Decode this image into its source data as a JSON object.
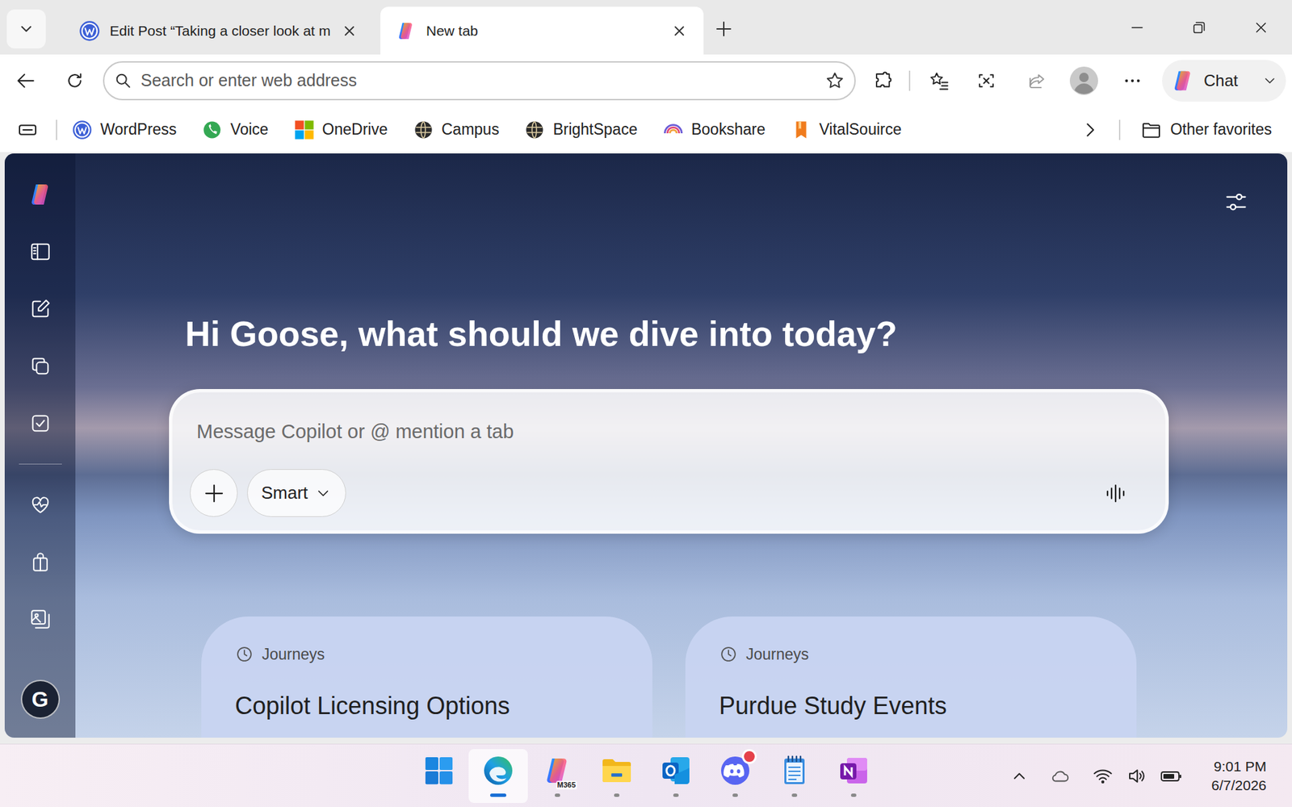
{
  "tabs": [
    {
      "label": "Edit Post “Taking a closer look at m",
      "selected": false,
      "kind": "wordpress"
    },
    {
      "label": "New tab",
      "selected": true,
      "kind": "copilot"
    }
  ],
  "address_bar": {
    "placeholder": "Search or enter web address"
  },
  "chat_button": {
    "label": "Chat"
  },
  "favorites": {
    "items": [
      {
        "label": "WordPress",
        "kind": "wordpress"
      },
      {
        "label": "Voice",
        "kind": "voice"
      },
      {
        "label": "OneDrive",
        "kind": "microsoft"
      },
      {
        "label": "Campus",
        "kind": "globe"
      },
      {
        "label": "BrightSpace",
        "kind": "globe"
      },
      {
        "label": "Bookshare",
        "kind": "bookshare"
      },
      {
        "label": "VitalSouirce",
        "kind": "vitalsource"
      }
    ],
    "other": "Other favorites"
  },
  "copilot": {
    "greeting": "Hi Goose, what should we dive into today?",
    "input": {
      "placeholder": "Message Copilot or @ mention a tab"
    },
    "mode": "Smart",
    "avatar": "G",
    "cards": [
      {
        "tag": "Journeys",
        "title": "Copilot Licensing Options"
      },
      {
        "tag": "Journeys",
        "title": "Purdue Study Events"
      }
    ]
  },
  "taskbar": {
    "apps": [
      {
        "kind": "start",
        "selected": false,
        "running": false,
        "notification": false
      },
      {
        "kind": "edge",
        "selected": true,
        "running": true,
        "notification": false
      },
      {
        "kind": "m365",
        "label": "M365",
        "selected": false,
        "running": true,
        "notification": false
      },
      {
        "kind": "explorer",
        "selected": false,
        "running": true,
        "notification": false
      },
      {
        "kind": "outlook",
        "selected": false,
        "running": true,
        "notification": false
      },
      {
        "kind": "discord",
        "selected": false,
        "running": true,
        "notification": true
      },
      {
        "kind": "notepad",
        "selected": false,
        "running": true,
        "notification": false
      },
      {
        "kind": "onenote",
        "selected": false,
        "running": true,
        "notification": false
      }
    ],
    "time": "9:01 PM",
    "date": "6/7/2026"
  }
}
